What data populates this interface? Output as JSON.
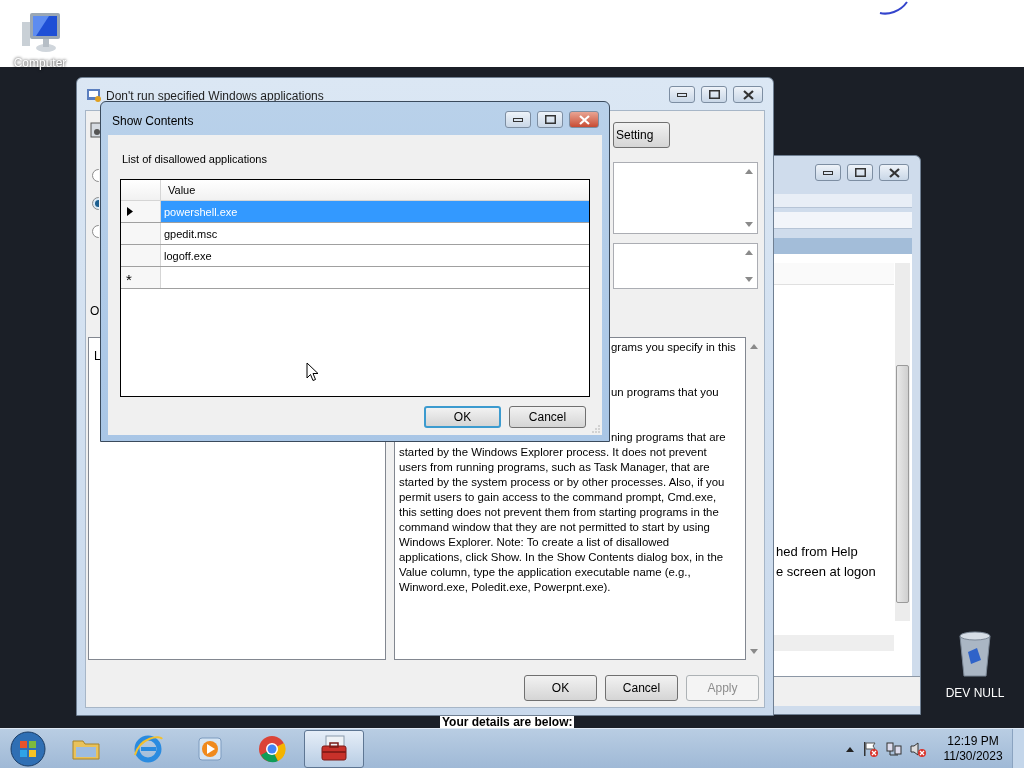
{
  "desktop": {
    "icons": [
      {
        "label": "Computer",
        "kind": "computer"
      },
      {
        "label": "DEV NULL",
        "kind": "recycle-bin"
      }
    ],
    "background_text": "Your details are below:"
  },
  "background_window": {
    "lines": [
      "hed from Help",
      "e screen at logon"
    ]
  },
  "policy_window": {
    "title": "Don't run specified Windows applications",
    "setting_button": "Setting",
    "state_options": [
      {
        "selected": false
      },
      {
        "selected": true
      },
      {
        "selected": false
      }
    ],
    "options_label": "O",
    "options_panel_text": "L",
    "help_lines": [
      {
        "text": "grams you specify in this",
        "covered": true
      },
      {
        "text": "un programs that you",
        "covered": true
      },
      {
        "text": "ning programs that are",
        "covered": true
      },
      {
        "text": "started by the Windows Explorer process. It does not prevent",
        "covered": false
      },
      {
        "text": "users from running programs, such as Task Manager, that are",
        "covered": false
      },
      {
        "text": "started by the system process or by other processes. Also, if you",
        "covered": false
      },
      {
        "text": "permit users to gain access to the command prompt, Cmd.exe,",
        "covered": false
      },
      {
        "text": "this setting does not prevent them from starting programs in the",
        "covered": false
      },
      {
        "text": "command window that they are not permitted to start by using",
        "covered": false
      },
      {
        "text": "Windows Explorer. Note: To create a list of disallowed",
        "covered": false
      },
      {
        "text": "applications, click Show. In the Show Contents dialog box, in the",
        "covered": false
      },
      {
        "text": "Value column, type the application executable name (e.g.,",
        "covered": false
      },
      {
        "text": "Winword.exe, Poledit.exe, Powerpnt.exe).",
        "covered": false
      }
    ],
    "buttons": [
      {
        "label": "OK",
        "disabled": false
      },
      {
        "label": "Cancel",
        "disabled": false
      },
      {
        "label": "Apply",
        "disabled": true
      }
    ]
  },
  "dialog": {
    "title": "Show Contents",
    "caption": "List of disallowed applications",
    "column": "Value",
    "rows": [
      {
        "value": "powershell.exe",
        "selected": true
      },
      {
        "value": "gpedit.msc",
        "selected": false
      },
      {
        "value": "logoff.exe",
        "selected": false
      }
    ],
    "new_row_marker": "*",
    "buttons": [
      {
        "label": "OK",
        "default": true
      },
      {
        "label": "Cancel",
        "default": false
      }
    ]
  },
  "taskbar": {
    "apps": [
      {
        "kind": "folder",
        "active": false
      },
      {
        "kind": "globe",
        "active": false
      },
      {
        "kind": "media",
        "active": false
      },
      {
        "kind": "chrome",
        "active": false
      },
      {
        "kind": "toolbox",
        "active": true
      }
    ],
    "time": "12:19 PM",
    "date": "11/30/2023"
  }
}
